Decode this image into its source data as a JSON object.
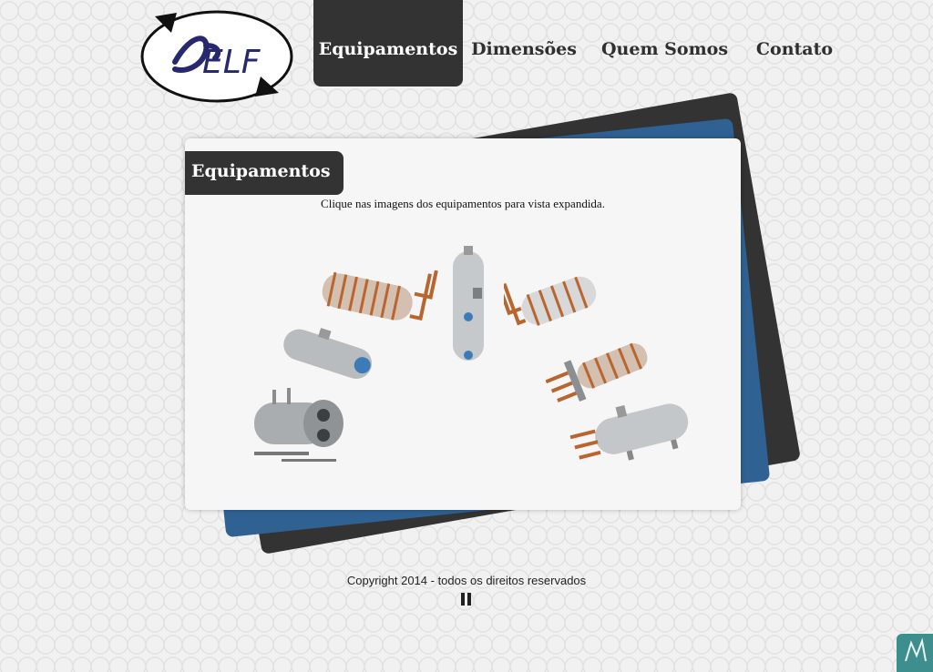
{
  "logo": {
    "text": "ELF",
    "swash": "S",
    "color": "#28286e"
  },
  "nav": {
    "items": [
      {
        "label": "Equipamentos",
        "active": true
      },
      {
        "label": "Dimensões",
        "active": false
      },
      {
        "label": "Quem Somos",
        "active": false
      },
      {
        "label": "Contato",
        "active": false
      }
    ]
  },
  "card": {
    "title": "Equipamentos",
    "intro": "Clique nas imagens dos equipamentos para vista expandida."
  },
  "gallery": [
    {
      "icon": "horizontal-tank-large-icon"
    },
    {
      "icon": "horizontal-tank-small-icon"
    },
    {
      "icon": "coil-heater-icon"
    },
    {
      "icon": "vertical-tank-icon"
    },
    {
      "icon": "coil-heater-angled-icon"
    },
    {
      "icon": "flanged-heater-icon"
    },
    {
      "icon": "steel-tank-heater-icon"
    }
  ],
  "footer": {
    "copyright": "Copyright 2014 - todos os direitos reservados"
  },
  "colors": {
    "dark": "#333333",
    "blue": "#306193",
    "copper": "#b9652f",
    "steel": "#c5c9cc",
    "teal": "#3f8e8e"
  }
}
